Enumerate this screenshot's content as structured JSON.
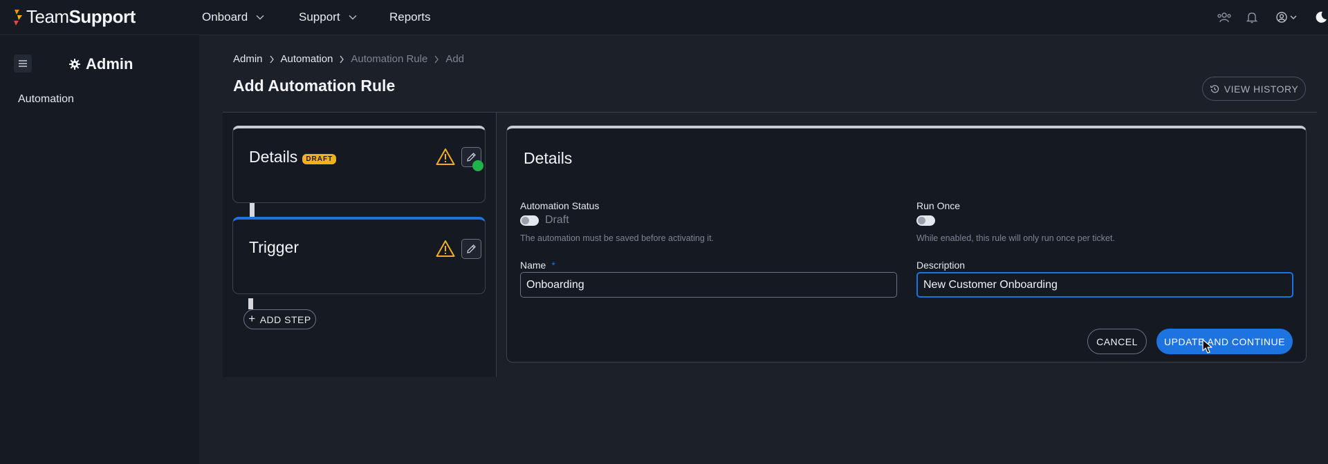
{
  "app": {
    "logo_text_light": "Team",
    "logo_text_bold": "Support",
    "colors": {
      "accent": "#1d73e0",
      "warning": "#f2b01e",
      "success": "#20b34a",
      "background": "#1b2029"
    }
  },
  "topnav": {
    "items": [
      {
        "label": "Onboard",
        "has_dropdown": true
      },
      {
        "label": "Support",
        "has_dropdown": true
      },
      {
        "label": "Reports",
        "has_dropdown": false
      }
    ],
    "icons": [
      "team-icon",
      "bell-icon",
      "user-account-icon",
      "dark-mode-icon"
    ]
  },
  "sidebar": {
    "title": "Admin",
    "items": [
      {
        "label": "Automation"
      }
    ]
  },
  "breadcrumb": [
    "Admin",
    "Automation",
    "Automation Rule",
    "Add"
  ],
  "page": {
    "title": "Add Automation Rule",
    "view_history_label": "VIEW HISTORY"
  },
  "steps": {
    "details": {
      "title": "Details",
      "badge": "DRAFT"
    },
    "trigger": {
      "title": "Trigger"
    },
    "add_step_label": "ADD STEP"
  },
  "form": {
    "title": "Details",
    "status": {
      "label": "Automation Status",
      "toggle_label": "Draft",
      "help": "The automation must be saved before activating it.",
      "enabled": false
    },
    "run_once": {
      "label": "Run Once",
      "help": "While enabled, this rule will only run once per ticket.",
      "enabled": false
    },
    "name": {
      "label": "Name",
      "required_mark": "*",
      "value": "Onboarding"
    },
    "description": {
      "label": "Description",
      "value": "New Customer Onboarding"
    },
    "cancel_label": "CANCEL",
    "submit_label": "UPDATE AND CONTINUE"
  }
}
